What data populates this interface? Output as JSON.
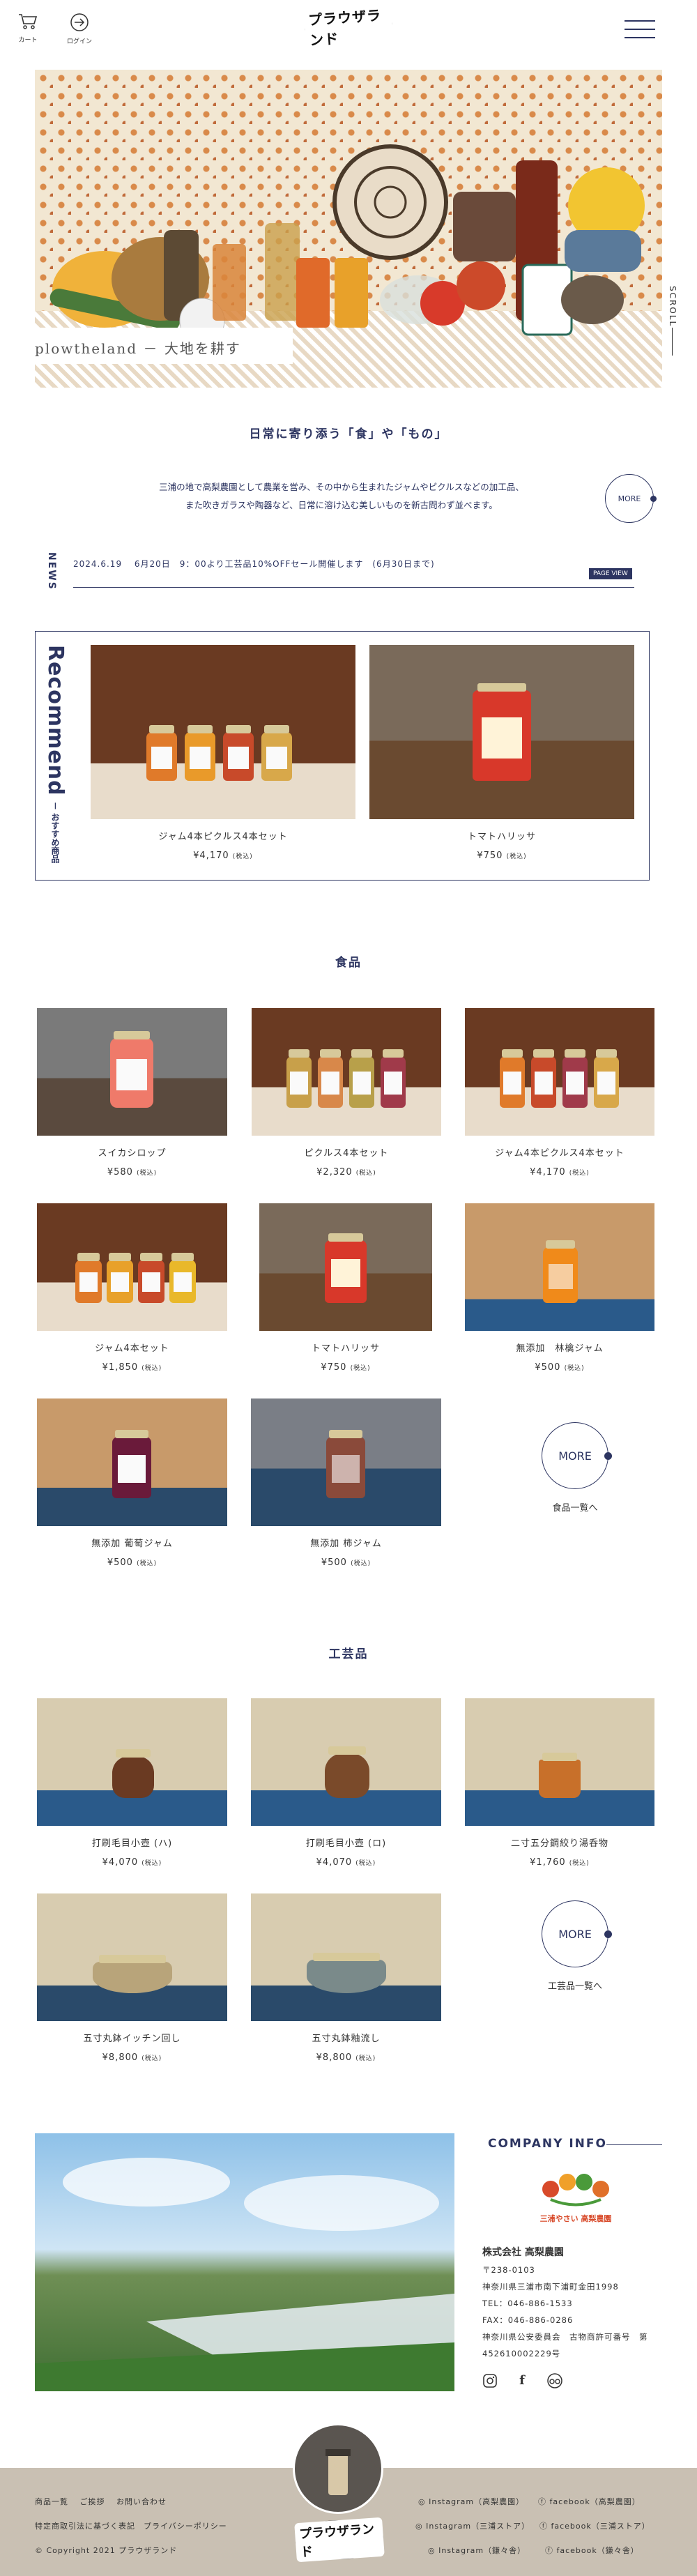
{
  "header": {
    "cart_label": "カート",
    "login_label": "ログイン",
    "logo_text": "プラウザランド"
  },
  "hero": {
    "caption": "plowtheland － 大地を耕す",
    "scroll_label": "SCROLL"
  },
  "intro": {
    "title": "日常に寄り添う「食」や「もの」",
    "line1": "三浦の地で高梨農園として農業を営み、その中から生まれたジャムやピクルスなどの加工品、",
    "line2": "また吹きガラスや陶器など、日常に溶け込む美しいものを新古問わず並べます。",
    "more_label": "MORE"
  },
  "news": {
    "label": "NEWS",
    "text": "2024.6.19　 6月20日　9：00より工芸品10%OFFセール開催します　(6月30日まで)",
    "button": "PAGE VIEW"
  },
  "recommend": {
    "title": "Recommend",
    "subtitle": "－ おすすめ商品",
    "items": [
      {
        "name": "ジャム4本ピクルス4本セット",
        "price": "¥4,170",
        "tax": "(税込)"
      },
      {
        "name": "トマトハリッサ",
        "price": "¥750",
        "tax": "(税込)"
      }
    ]
  },
  "food": {
    "title": "食品",
    "items": [
      {
        "name": "スイカシロップ",
        "price": "¥580",
        "tax": "(税込)"
      },
      {
        "name": "ピクルス4本セット",
        "price": "¥2,320",
        "tax": "(税込)"
      },
      {
        "name": "ジャム4本ピクルス4本セット",
        "price": "¥4,170",
        "tax": "(税込)"
      },
      {
        "name": "ジャム4本セット",
        "price": "¥1,850",
        "tax": "(税込)"
      },
      {
        "name": "トマトハリッサ",
        "price": "¥750",
        "tax": "(税込)"
      },
      {
        "name": "無添加　林檎ジャム",
        "price": "¥500",
        "tax": "(税込)"
      },
      {
        "name": "無添加 葡萄ジャム",
        "price": "¥500",
        "tax": "(税込)"
      },
      {
        "name": "無添加 柿ジャム",
        "price": "¥500",
        "tax": "(税込)"
      }
    ],
    "more_label": "MORE",
    "more_text": "食品一覧へ"
  },
  "crafts": {
    "title": "工芸品",
    "items": [
      {
        "name": "打刷毛目小壺 (ハ)",
        "price": "¥4,070",
        "tax": "(税込)"
      },
      {
        "name": "打刷毛目小壺 (ロ)",
        "price": "¥4,070",
        "tax": "(税込)"
      },
      {
        "name": "二寸五分鋼絞り湯呑物",
        "price": "¥1,760",
        "tax": "(税込)"
      },
      {
        "name": "五寸丸鉢イッチン回し",
        "price": "¥8,800",
        "tax": "(税込)"
      },
      {
        "name": "五寸丸鉢釉流し",
        "price": "¥8,800",
        "tax": "(税込)"
      }
    ],
    "more_label": "MORE",
    "more_text": "工芸品一覧へ"
  },
  "company": {
    "title": "COMPANY INFO",
    "badge_text": "三浦やさい 高梨農園",
    "name": "株式会社 高梨農園",
    "zip": "〒238-0103",
    "address": "神奈川県三浦市南下浦町金田1998",
    "tel": "TEL：046-886-1533",
    "fax": "FAX：046-886-0286",
    "license1": "神奈川県公安委員会　古物商許可番号　第",
    "license2": "452610002229号"
  },
  "footer": {
    "links": [
      "商品一覧",
      "ご挨拶",
      "お問い合わせ"
    ],
    "law": "特定商取引法に基づく表記　プライバシーポリシー",
    "copyright": "© Copyright 2021 プラウザランド",
    "wordmark": "プラウザランド",
    "sns": [
      "Instagram（高梨農園）",
      "facebook（高梨農園）",
      "Instagram（三浦ストア）",
      "facebook（三浦ストア）",
      "Instagram（鎌々舎）",
      "facebook（鎌々舎）"
    ]
  }
}
